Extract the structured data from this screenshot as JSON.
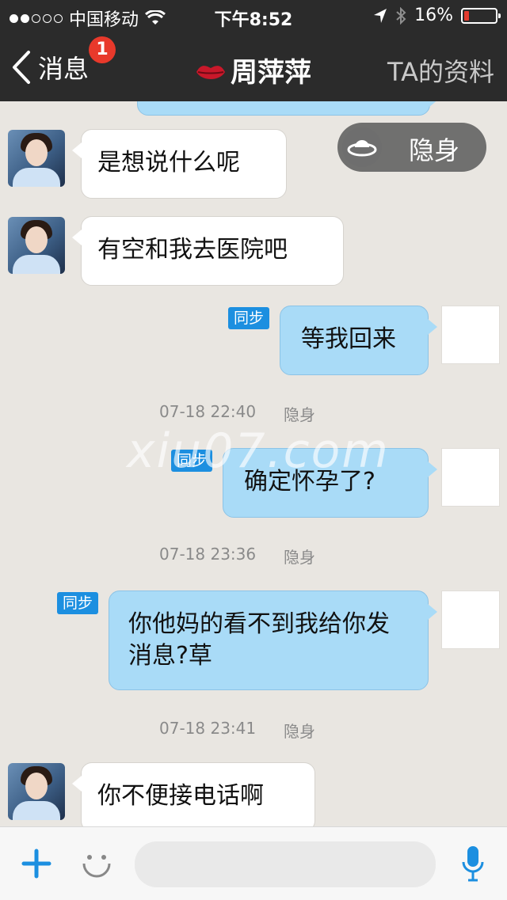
{
  "status_bar": {
    "carrier": "中国移动",
    "time": "下午8:52",
    "battery": "16%",
    "battery_level": 0.16,
    "signal_filled": 2,
    "signal_total": 5
  },
  "nav": {
    "back_label": "消息",
    "unread_badge": "1",
    "title": "周萍萍",
    "right_label": "TA的资料"
  },
  "hide_toggle": {
    "label": "隐身"
  },
  "messages": [
    {
      "direction": "in",
      "text": "是想说什么呢"
    },
    {
      "direction": "in",
      "text": "有空和我去医院吧"
    },
    {
      "direction": "out",
      "text": "等我回来",
      "tag": "同步"
    },
    {
      "timestamp": "07-18 22:40",
      "status": "隐身"
    },
    {
      "direction": "out",
      "text": "确定怀孕了?",
      "tag": "同步"
    },
    {
      "timestamp": "07-18 23:36",
      "status": "隐身"
    },
    {
      "direction": "out",
      "text": "你他妈的看不到我给你发消息?草",
      "tag": "同步"
    },
    {
      "timestamp": "07-18 23:41",
      "status": "隐身"
    },
    {
      "direction": "in",
      "text": "你不便接电话啊"
    }
  ],
  "watermark": "xiu07.com",
  "input": {
    "placeholder": ""
  },
  "icons": [
    "back-chevron-icon",
    "lips-icon",
    "ufo-icon",
    "plus-icon",
    "smiley-icon",
    "microphone-icon",
    "wifi-icon",
    "location-arrow-icon",
    "bluetooth-icon"
  ]
}
